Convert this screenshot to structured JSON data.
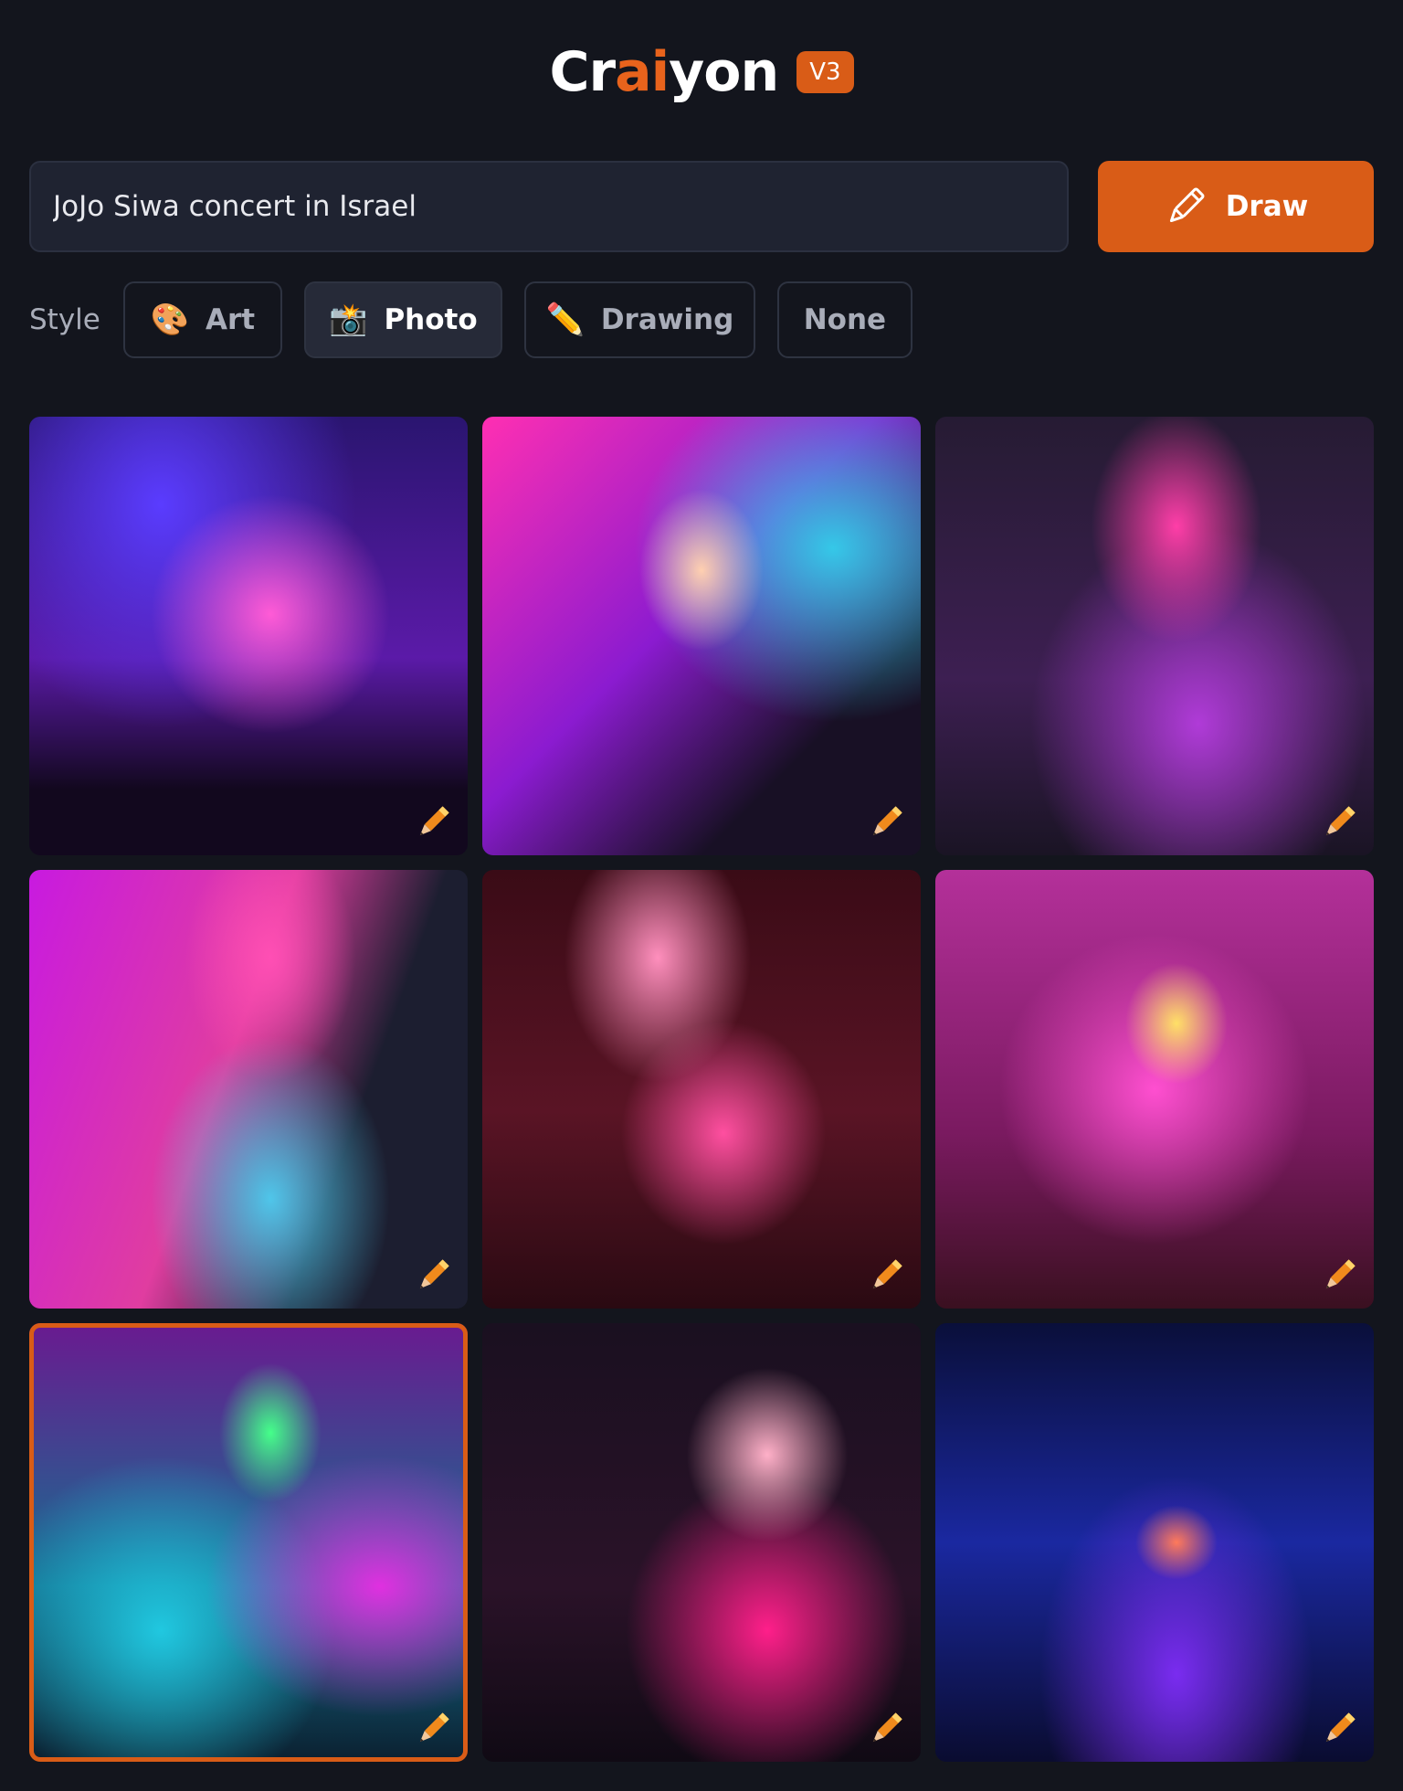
{
  "header": {
    "logo_prefix": "Cr",
    "logo_accent": "ai",
    "logo_suffix": "yon",
    "version_badge": "V3"
  },
  "search": {
    "prompt_value": "JoJo Siwa concert in Israel",
    "draw_label": "Draw"
  },
  "style": {
    "label": "Style",
    "options": [
      {
        "emoji": "🎨",
        "label": "Art",
        "active": false
      },
      {
        "emoji": "📸",
        "label": "Photo",
        "active": true
      },
      {
        "emoji": "✏️",
        "label": "Drawing",
        "active": false
      },
      {
        "emoji": "",
        "label": "None",
        "active": false
      }
    ]
  },
  "results": {
    "count": 9,
    "selected_index": 6,
    "edit_icon": "pencil-icon"
  },
  "colors": {
    "accent": "#d95c17",
    "background": "#13151d",
    "input_bg": "#1f2331"
  }
}
